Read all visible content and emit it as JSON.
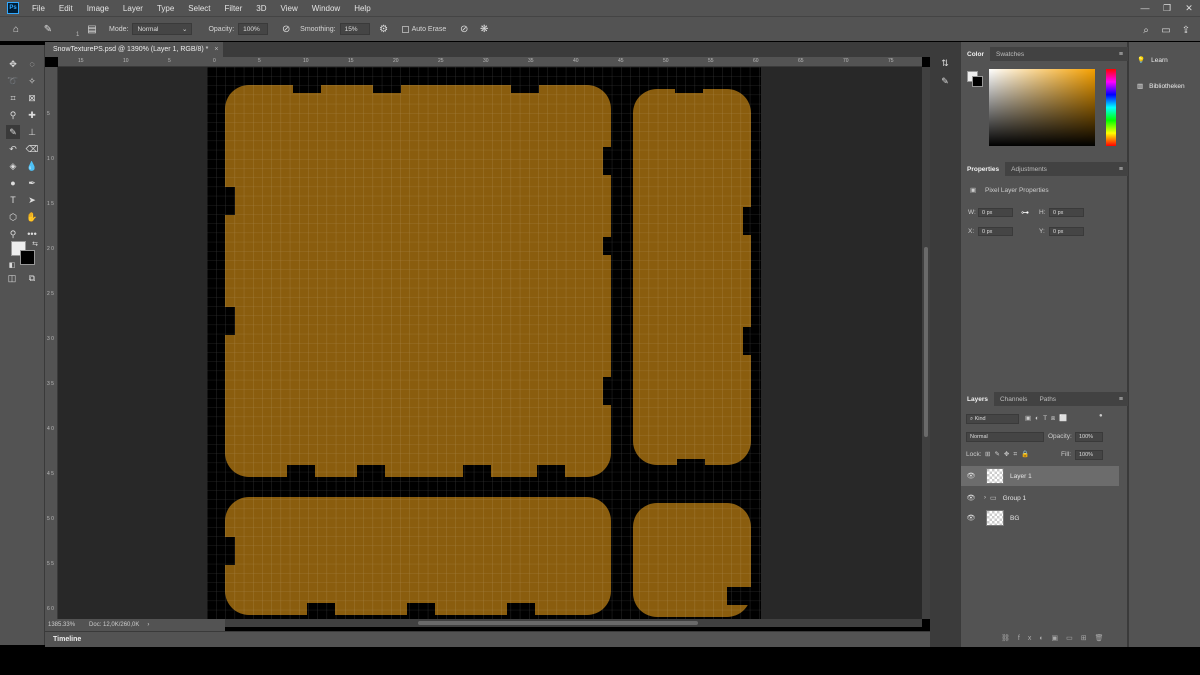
{
  "menu": {
    "logo": "Ps",
    "items": [
      "File",
      "Edit",
      "Image",
      "Layer",
      "Type",
      "Select",
      "Filter",
      "3D",
      "View",
      "Window",
      "Help"
    ]
  },
  "options": {
    "mode_label": "Mode:",
    "mode_value": "Normal",
    "opacity_label": "Opacity:",
    "opacity_value": "100%",
    "smoothing_label": "Smoothing:",
    "smoothing_value": "15%",
    "auto_erase_label": "Auto Erase",
    "brush_size": "1"
  },
  "document": {
    "tab_title": "SnowTexturePS.psd @ 1390% (Layer 1, RGB/8) *",
    "close": "×"
  },
  "ruler_h": [
    "15",
    "10",
    "5",
    "0",
    "5",
    "10",
    "15",
    "20",
    "25",
    "30",
    "35",
    "40",
    "45",
    "50",
    "55",
    "60",
    "65",
    "70",
    "75",
    "80"
  ],
  "ruler_v": [
    "5",
    "1 0",
    "1 5",
    "2 0",
    "2 5",
    "3 0",
    "3 5",
    "4 0",
    "4 5",
    "5 0",
    "5 5",
    "6 0"
  ],
  "status": {
    "zoom": "1385.33%",
    "doc": "Doc: 12,0K/260,0K"
  },
  "timeline_label": "Timeline",
  "color_panel": {
    "tabs": [
      "Color",
      "Swatches"
    ]
  },
  "properties_panel": {
    "tabs": [
      "Properties",
      "Adjustments"
    ],
    "title": "Pixel Layer Properties",
    "w_label": "W:",
    "w_value": "0 px",
    "h_label": "H:",
    "h_value": "0 px",
    "x_label": "X:",
    "x_value": "0 px",
    "y_label": "Y:",
    "y_value": "0 px"
  },
  "layers_panel": {
    "tabs": [
      "Layers",
      "Channels",
      "Paths"
    ],
    "filter": "Kind",
    "blend": "Normal",
    "opacity_label": "Opacity:",
    "opacity_value": "100%",
    "lock_label": "Lock:",
    "fill_label": "Fill:",
    "fill_value": "100%",
    "layers": [
      {
        "name": "Layer 1"
      },
      {
        "name": "Group 1"
      },
      {
        "name": "BG"
      }
    ]
  },
  "right_dock": {
    "learn": "Learn",
    "libraries": "Bibliotheken"
  },
  "colors": {
    "fill": "#8a5d0e",
    "border": "#000000",
    "bg": "#535353"
  }
}
